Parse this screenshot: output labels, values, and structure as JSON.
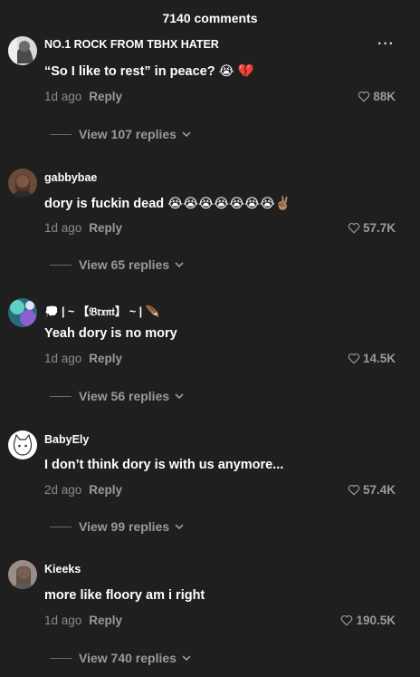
{
  "header": {
    "title": "7140 comments"
  },
  "comments": [
    {
      "username": "NO.1 ROCK FROM TBHX HATER",
      "text": "“So I like to rest” in peace? 😭 💔",
      "age": "1d ago",
      "reply": "Reply",
      "likes": "88K",
      "view": "View 107 replies"
    },
    {
      "username": "gabbybae",
      "text": "dory is fuckin dead 😭😭😭😭😭😭😭✌🏽",
      "age": "1d ago",
      "reply": "Reply",
      "likes": "57.7K",
      "view": "View 65 replies"
    },
    {
      "username": "💭 | ~ 【𝔅𝔯𝔵𝔫𝔱】 ~ | 🪶",
      "text": "Yeah dory is no mory",
      "age": "1d ago",
      "reply": "Reply",
      "likes": "14.5K",
      "view": "View 56 replies"
    },
    {
      "username": "BabyEly",
      "text": "I don’t think dory is with us anymore...",
      "age": "2d ago",
      "reply": "Reply",
      "likes": "57.4K",
      "view": "View 99 replies"
    },
    {
      "username": "Kieeks",
      "text": "more like floory am i right",
      "age": "1d ago",
      "reply": "Reply",
      "likes": "190.5K",
      "view": "View 740 replies"
    }
  ],
  "more_glyph": "···",
  "colors": {
    "background": "#1f1f1f",
    "text": "#ffffff",
    "muted": "#8a8a8a",
    "heart_broken": "#e8365a"
  },
  "icons": {
    "like": "heart-outline-icon",
    "expand": "chevron-down-icon",
    "more": "more-options-icon"
  }
}
